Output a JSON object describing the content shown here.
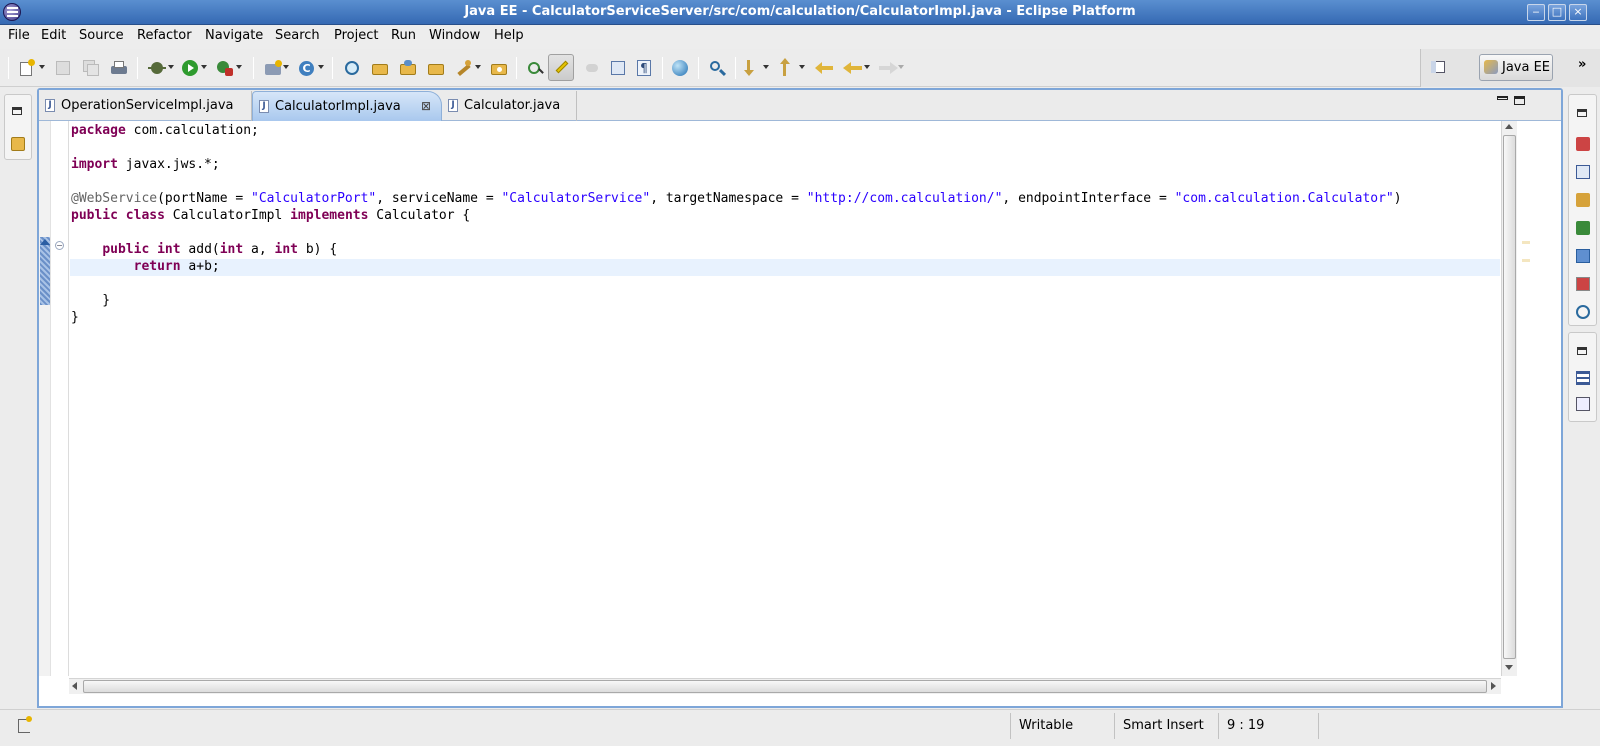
{
  "window": {
    "title": "Java EE - CalculatorServiceServer/src/com/calculation/CalculatorImpl.java - Eclipse Platform",
    "buttons": [
      "minimize",
      "maximize",
      "close"
    ]
  },
  "menu": [
    "File",
    "Edit",
    "Source",
    "Refactor",
    "Navigate",
    "Search",
    "Project",
    "Run",
    "Window",
    "Help"
  ],
  "perspective": {
    "label": "Java EE"
  },
  "tabs": [
    {
      "label": "OperationServiceImpl.java",
      "active": false
    },
    {
      "label": "CalculatorImpl.java",
      "active": true
    },
    {
      "label": "Calculator.java",
      "active": false
    }
  ],
  "code": {
    "current_line": 9,
    "lines": [
      [
        {
          "t": "package",
          "c": "kw"
        },
        {
          "t": " com.calculation;"
        }
      ],
      [],
      [
        {
          "t": "import",
          "c": "kw"
        },
        {
          "t": " javax.jws.*;"
        }
      ],
      [],
      [
        {
          "t": "@WebService",
          "c": "ann"
        },
        {
          "t": "(portName = "
        },
        {
          "t": "\"CalculatorPort\"",
          "c": "str"
        },
        {
          "t": ", serviceName = "
        },
        {
          "t": "\"CalculatorService\"",
          "c": "str"
        },
        {
          "t": ", targetNamespace = "
        },
        {
          "t": "\"http://com.calculation/\"",
          "c": "str"
        },
        {
          "t": ", endpointInterface = "
        },
        {
          "t": "\"com.calculation.Calculator\"",
          "c": "str"
        },
        {
          "t": ")"
        }
      ],
      [
        {
          "t": "public",
          "c": "kw"
        },
        {
          "t": " "
        },
        {
          "t": "class",
          "c": "kw"
        },
        {
          "t": " CalculatorImpl "
        },
        {
          "t": "implements",
          "c": "kw"
        },
        {
          "t": " Calculator {"
        }
      ],
      [],
      [
        {
          "t": "    "
        },
        {
          "t": "public",
          "c": "kw"
        },
        {
          "t": " "
        },
        {
          "t": "int",
          "c": "kw"
        },
        {
          "t": " add("
        },
        {
          "t": "int",
          "c": "kw"
        },
        {
          "t": " a, "
        },
        {
          "t": "int",
          "c": "kw"
        },
        {
          "t": " b) {"
        }
      ],
      [
        {
          "t": "        "
        },
        {
          "t": "return",
          "c": "kw"
        },
        {
          "t": " a+b;"
        }
      ],
      [],
      [
        {
          "t": "    }"
        }
      ],
      [
        {
          "t": "}"
        }
      ]
    ]
  },
  "status": {
    "writable": "Writable",
    "insert_mode": "Smart Insert",
    "position": "9 : 19"
  },
  "colors": {
    "accent": "#7ea6d8",
    "keyword": "#7f0055",
    "string": "#2a00ff",
    "annotation": "#646464"
  }
}
